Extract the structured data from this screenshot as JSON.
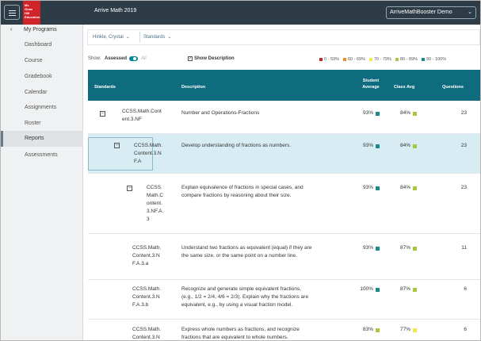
{
  "header": {
    "logo_lines": [
      "Mc",
      "Graw",
      "Hill",
      "Education"
    ],
    "app_title": "Arrive Math 2019",
    "user_label": "ArriveMathBooster Demo",
    "user_chevron": "⌄"
  },
  "sidebar": {
    "back_arrow": "‹",
    "back_label": "My Programs",
    "items": [
      {
        "label": "Dashboard",
        "active": false
      },
      {
        "label": "Course",
        "active": false
      },
      {
        "label": "Gradebook",
        "active": false
      },
      {
        "label": "Calendar",
        "active": false
      },
      {
        "label": "Assignments",
        "active": false
      },
      {
        "label": "Roster",
        "active": false
      },
      {
        "label": "Reports",
        "active": true
      },
      {
        "label": "Assessments",
        "active": false
      }
    ]
  },
  "filters": [
    {
      "label": "Hinkle, Crystal",
      "chevron": "⌄"
    },
    {
      "label": "Standards",
      "chevron": "⌄"
    }
  ],
  "show_row": {
    "label": "Show:",
    "value": "Assessed",
    "other": "All",
    "checkbox_mark": "✓",
    "show_description": "Show Description"
  },
  "legend": [
    {
      "label": "0 - 59%",
      "color": "#c0282d"
    },
    {
      "label": "60 - 69%",
      "color": "#f28c28"
    },
    {
      "label": "70 - 79%",
      "color": "#f3e64b"
    },
    {
      "label": "80 - 89%",
      "color": "#a6c83c"
    },
    {
      "label": "90 - 100%",
      "color": "#1b8a8a"
    }
  ],
  "table": {
    "columns": {
      "standards": "Standards",
      "description": "Description",
      "student_average_1": "Student",
      "student_average_2": "Average",
      "class_avg": "Class Avg",
      "questions": "Questions"
    },
    "rows": [
      {
        "standard_lines": [
          "CCSS.Math.Cont",
          "ent.3.NF"
        ],
        "expander": "−",
        "description_lines": [
          "Number and Operations-Fractions"
        ],
        "student_avg": "93%",
        "student_color": "#1b8a8a",
        "class_avg": "84%",
        "class_color": "#a6c83c",
        "questions": "23"
      },
      {
        "standard_lines": [
          "CCSS.Math.",
          "Content.3.N",
          "F.A"
        ],
        "expander": "−",
        "description_lines": [
          "Develop understanding of fractions as numbers."
        ],
        "student_avg": "93%",
        "student_color": "#1b8a8a",
        "class_avg": "84%",
        "class_color": "#a6c83c",
        "questions": "23"
      },
      {
        "standard_lines": [
          "CCSS.",
          "Math.C",
          "ontent.",
          "3.NF.A.",
          "3"
        ],
        "expander": "−",
        "description_lines": [
          "Explain equivalence of fractions in special cases, and",
          "compare fractions by reasoning about their size."
        ],
        "student_avg": "93%",
        "student_color": "#1b8a8a",
        "class_avg": "84%",
        "class_color": "#a6c83c",
        "questions": "23"
      },
      {
        "standard_lines": [
          "CCSS.Math.",
          "Content.3.N",
          "F.A.3.a"
        ],
        "description_lines": [
          "Understand two fractions as equivalent (equal) if they are",
          "the same size, or the same point on a number line."
        ],
        "student_avg": "93%",
        "student_color": "#1b8a8a",
        "class_avg": "87%",
        "class_color": "#a6c83c",
        "questions": "11"
      },
      {
        "standard_lines": [
          "CCSS.Math.",
          "Content.3.N",
          "F.A.3.b"
        ],
        "description_lines": [
          "Recognize and generate simple equivalent fractions,",
          "(e.g., 1/2 = 2/4, 4/6 = 2/3). Explain why the fractions are",
          "equivalent, e.g., by using a visual fraction model."
        ],
        "student_avg": "100%",
        "student_color": "#1b8a8a",
        "class_avg": "87%",
        "class_color": "#a6c83c",
        "questions": "6"
      },
      {
        "standard_lines": [
          "CCSS.Math.",
          "Content.3.N"
        ],
        "description_lines": [
          "Express whole numbers as fractions, and recognize",
          "fractions that are equivalent to whole numbers."
        ],
        "student_avg": "83%",
        "student_color": "#a6c83c",
        "class_avg": "77%",
        "class_color": "#f3e64b",
        "questions": "6"
      }
    ]
  }
}
